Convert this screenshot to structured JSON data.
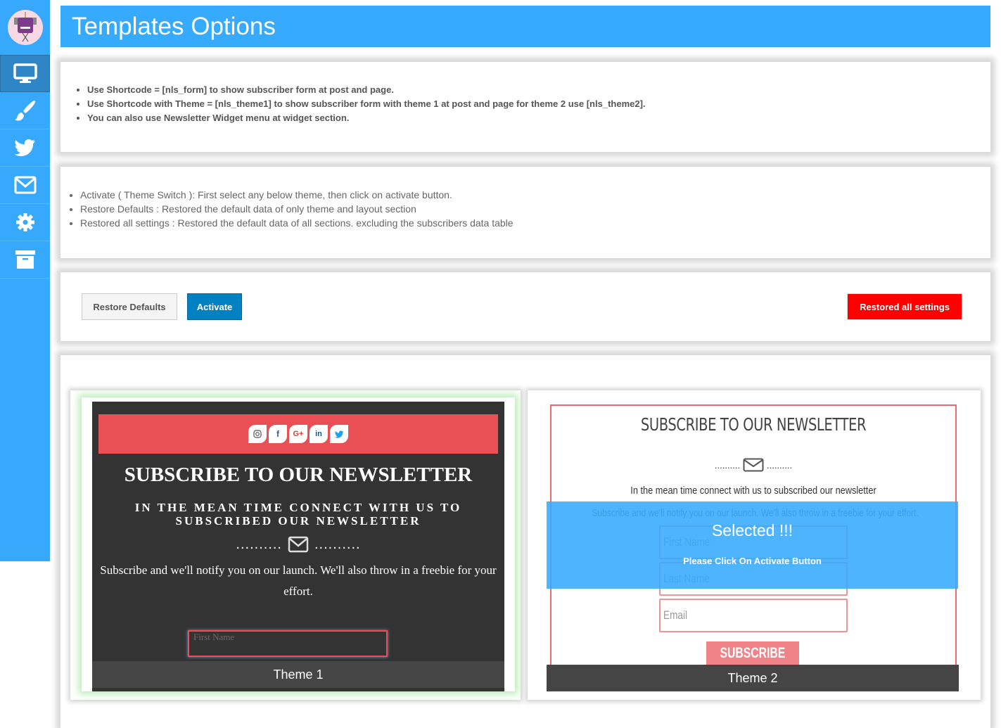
{
  "sidebar": {
    "avatar_alt": "monster avatar",
    "items": [
      {
        "name": "display",
        "icon": "desktop-icon",
        "active": true
      },
      {
        "name": "design",
        "icon": "paintbrush-icon",
        "active": false
      },
      {
        "name": "social",
        "icon": "twitter-icon",
        "active": false
      },
      {
        "name": "email",
        "icon": "envelope-icon",
        "active": false
      },
      {
        "name": "settings",
        "icon": "gear-icon",
        "active": false
      },
      {
        "name": "archive",
        "icon": "archive-icon",
        "active": false
      }
    ]
  },
  "header": {
    "title": "Templates Options"
  },
  "shortcode_info": [
    "Use Shortcode = [nls_form] to show subscriber form at post and page.",
    "Use Shortcode with  Theme = [nls_theme1] to show subscriber form with theme 1 at post and page for theme 2 use [nls_theme2].",
    "You can also use Newsletter Widget menu at widget section."
  ],
  "action_info": [
    "Activate ( Theme Switch ): First select any below theme, then click on activate button.",
    "Restore Defaults : Restored the default data of only theme and layout section",
    "Restored all settings : Restored the default data of all sections. excluding the subscribers data table"
  ],
  "actions": {
    "restore_defaults": "Restore Defaults",
    "activate": "Activate",
    "restore_all": "Restored all settings"
  },
  "colors": {
    "brand": "#36aafd",
    "activate": "#0181c2",
    "danger": "#ff0000",
    "theme_accent": "#ea4f55"
  },
  "theme1": {
    "label": "Theme 1",
    "social": [
      "instagram",
      "facebook",
      "google-plus",
      "linkedin",
      "twitter"
    ],
    "title": "SUBSCRIBE TO OUR NEWSLETTER",
    "subtitle_line1": "IN THE MEAN TIME CONNECT WITH US TO",
    "subtitle_line2": "SUBSCRIBED OUR NEWSLETTER",
    "dots": "..........",
    "description": "Subscribe and we'll notify you on our launch. We'll also throw in a freebie for your effort.",
    "first_name_placeholder": "First Name"
  },
  "theme2": {
    "label": "Theme 2",
    "title": "SUBSCRIBE TO OUR NEWSLETTER",
    "dots": "..........",
    "subtitle": "In the mean time connect with us to subscribed our newsletter",
    "description": "Subscribe and we'll notify you on our launch. We'll also throw in a freebie for your effort.",
    "first_name_placeholder": "First Name",
    "last_name_placeholder": "Last Name",
    "email_placeholder": "Email",
    "subscribe_label": "SUBSCRIBE",
    "selected_text": "Selected !!!",
    "selected_hint": "Please Click On Activate Button"
  }
}
